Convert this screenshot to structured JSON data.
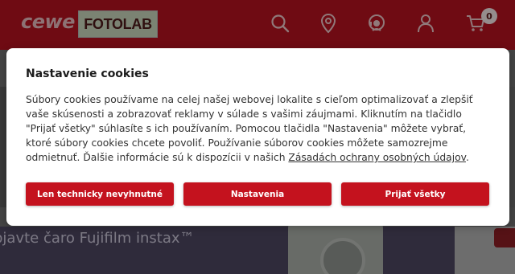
{
  "header": {
    "logo_cewe": "cewe",
    "logo_fotolab": "FOTOLAB",
    "icons": [
      "search-icon",
      "location-pin-icon",
      "support-agent-icon",
      "user-icon",
      "cart-icon"
    ],
    "cart_count": "0",
    "colors": {
      "brand_red": "#b3121f"
    }
  },
  "background": {
    "promo_text": "bjavte čaro Fujifilm instax™"
  },
  "cookie_dialog": {
    "title": "Nastavenie cookies",
    "body_text": "Súbory cookies používame na celej našej webovej lokalite s cieľom optimalizovať a zlepšiť vaše skúsenosti a zobrazovať reklamy v súlade s vašimi záujmami. Kliknutím na tlačidlo \"Prijať všetky\" súhlasíte s ich používaním. Pomocou tlačidla \"Nastavenia\" môžete vybrať, ktoré súbory cookies chcete povoliť. Používanie súborov cookies môžete samozrejme odmietnuť. Ďalšie informácie sú k dispozícii v našich ",
    "privacy_link": "Zásadách ochrany osobných údajov",
    "body_end": ".",
    "buttons": {
      "necessary": "Len technicky nevyhnutné",
      "settings": "Nastavenia",
      "accept_all": "Prijať všetky"
    },
    "colors": {
      "button_red": "#c4121e"
    }
  }
}
